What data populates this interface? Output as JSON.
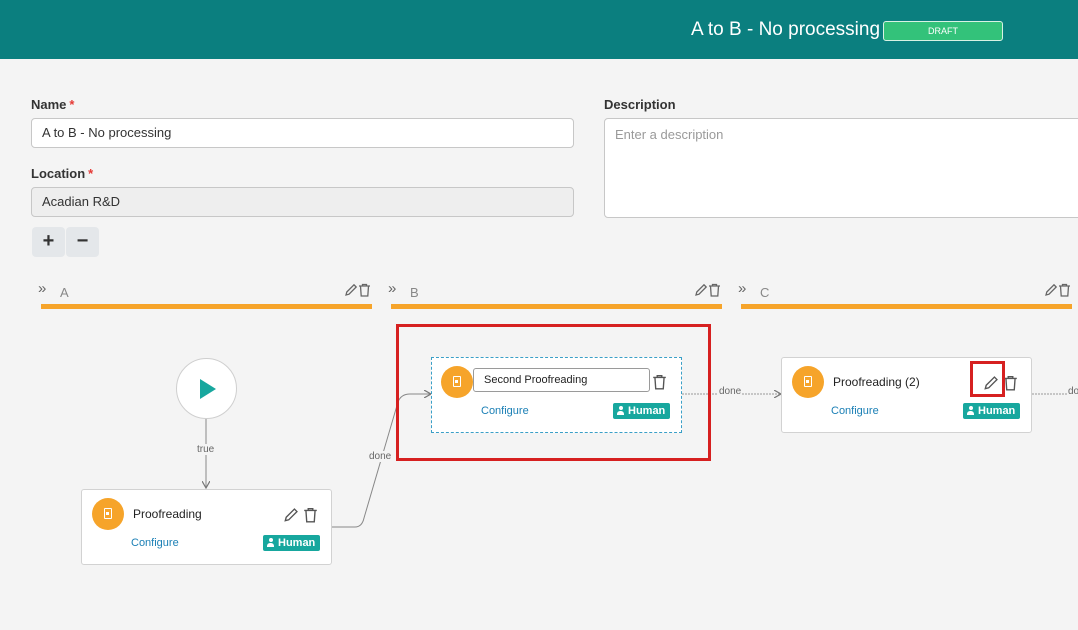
{
  "header": {
    "title": "A to B - No processing",
    "status": "DRAFT"
  },
  "form": {
    "name_label": "Name",
    "name_value": "A to B - No processing",
    "location_label": "Location",
    "location_value": "Acadian R&D",
    "required_mark": "*",
    "description_label": "Description",
    "description_placeholder": "Enter a description"
  },
  "zoom": {
    "in_label": "+",
    "out_label": "−"
  },
  "lanes": [
    {
      "name": "A"
    },
    {
      "name": "B"
    },
    {
      "name": "C"
    }
  ],
  "edges": {
    "true_label": "true",
    "done_label": "done"
  },
  "nodes": [
    {
      "title": "Proofreading",
      "configure": "Configure",
      "role": "Human"
    },
    {
      "title": "Second Proofreading",
      "configure": "Configure",
      "role": "Human"
    },
    {
      "title": "Proofreading (2)",
      "configure": "Configure",
      "role": "Human"
    }
  ],
  "icons": {
    "lane_expand": "chevrons-right-icon",
    "edit": "pencil-icon",
    "delete": "trash-icon",
    "start": "play-icon",
    "task": "document-icon",
    "human": "person-icon"
  },
  "colors": {
    "header": "#0b7f7f",
    "draft": "#33c27a",
    "lane_bar": "#f6a42a",
    "accent": "#17a79e",
    "highlight": "#d62020"
  }
}
